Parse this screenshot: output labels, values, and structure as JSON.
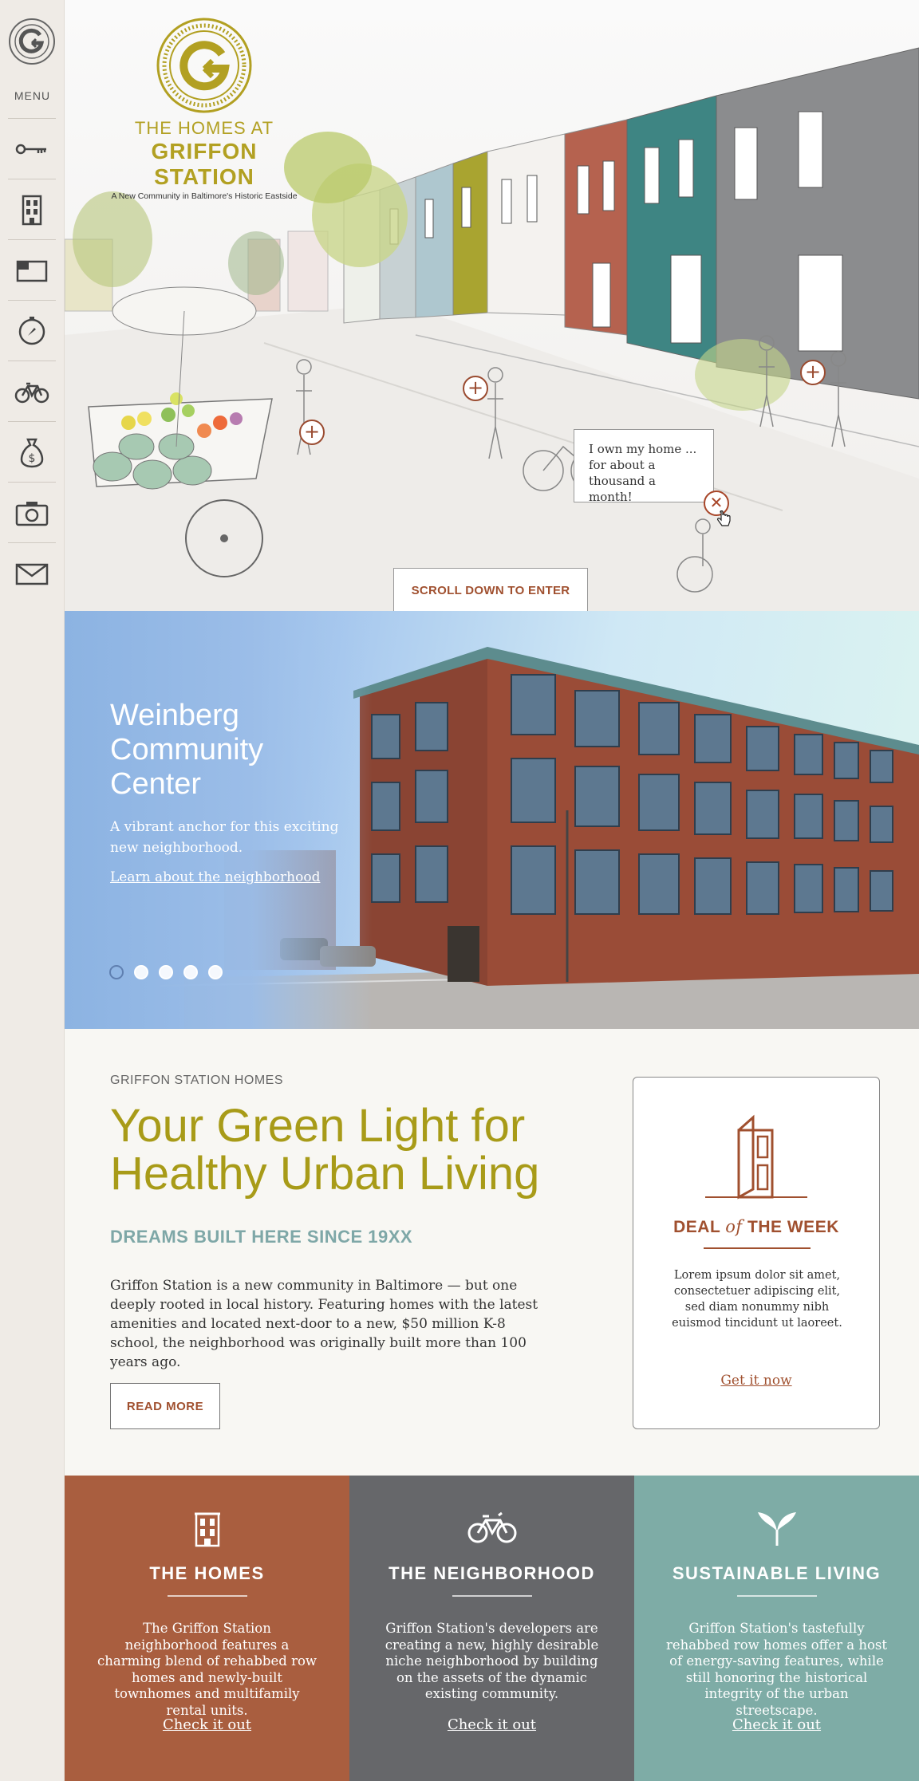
{
  "sidebar": {
    "menu_label": "MENU",
    "items": [
      {
        "name": "key-icon"
      },
      {
        "name": "building-icon"
      },
      {
        "name": "floorplan-icon"
      },
      {
        "name": "compass-icon"
      },
      {
        "name": "bicycle-icon"
      },
      {
        "name": "money-bag-icon"
      },
      {
        "name": "camera-icon"
      },
      {
        "name": "envelope-icon"
      }
    ]
  },
  "hero": {
    "logo_small": "THE HOMES AT",
    "logo_big": "GRIFFON STATION",
    "logo_tagline": "A New Community in Baltimore's Historic Eastside",
    "tooltip": "I own my home ... for about a thousand a month!",
    "scroll_label": "SCROLL DOWN TO ENTER"
  },
  "slider": {
    "title": "Weinberg Community Center",
    "subtitle": "A vibrant anchor for this exciting new neighborhood.",
    "link": "Learn about the neighborhood",
    "dot_count": 5,
    "active_dot": 1
  },
  "intro": {
    "kicker": "GRIFFON STATION HOMES",
    "headline": "Your Green Light for Healthy Urban Living",
    "subhead": "DREAMS BUILT HERE SINCE 19XX",
    "body": "Griffon Station is a new community in Baltimore — but one deeply rooted in local history. Featuring homes with the latest amenities and located next-door to a new, $50 million K-8 school, the neighborhood was originally built more than 100 years ago.",
    "button": "READ MORE"
  },
  "deal": {
    "title_a": "DEAL",
    "title_of": "of",
    "title_b": "THE WEEK",
    "text": "Lorem ipsum dolor sit amet, consectetuer adipiscing elit, sed diam nonummy nibh euismod tincidunt ut laoreet.",
    "link": "Get it now"
  },
  "panels": [
    {
      "title": "THE HOMES",
      "text": "The Griffon Station neighborhood features a charming blend of rehabbed row homes and newly-built townhomes and multifamily rental units.",
      "link": "Check it out",
      "color": "#a95e3f",
      "icon": "rowhouse-icon"
    },
    {
      "title": "THE NEIGHBORHOOD",
      "text": "Griffon Station's developers are creating a new, highly desirable niche neighborhood by building on the assets of the dynamic existing community.",
      "link": "Check it out",
      "color": "#66676a",
      "icon": "bicycle-icon"
    },
    {
      "title": "SUSTAINABLE LIVING",
      "text": "Griffon Station's tastefully rehabbed row homes offer a host of energy-saving features, while still honoring the historical integrity of the urban streetscape.",
      "link": "Check it out",
      "color": "#7eaca6",
      "icon": "leaves-icon"
    }
  ],
  "colors": {
    "accent": "#a0502f",
    "olive": "#a89b18",
    "teal": "#7ea7a7"
  }
}
